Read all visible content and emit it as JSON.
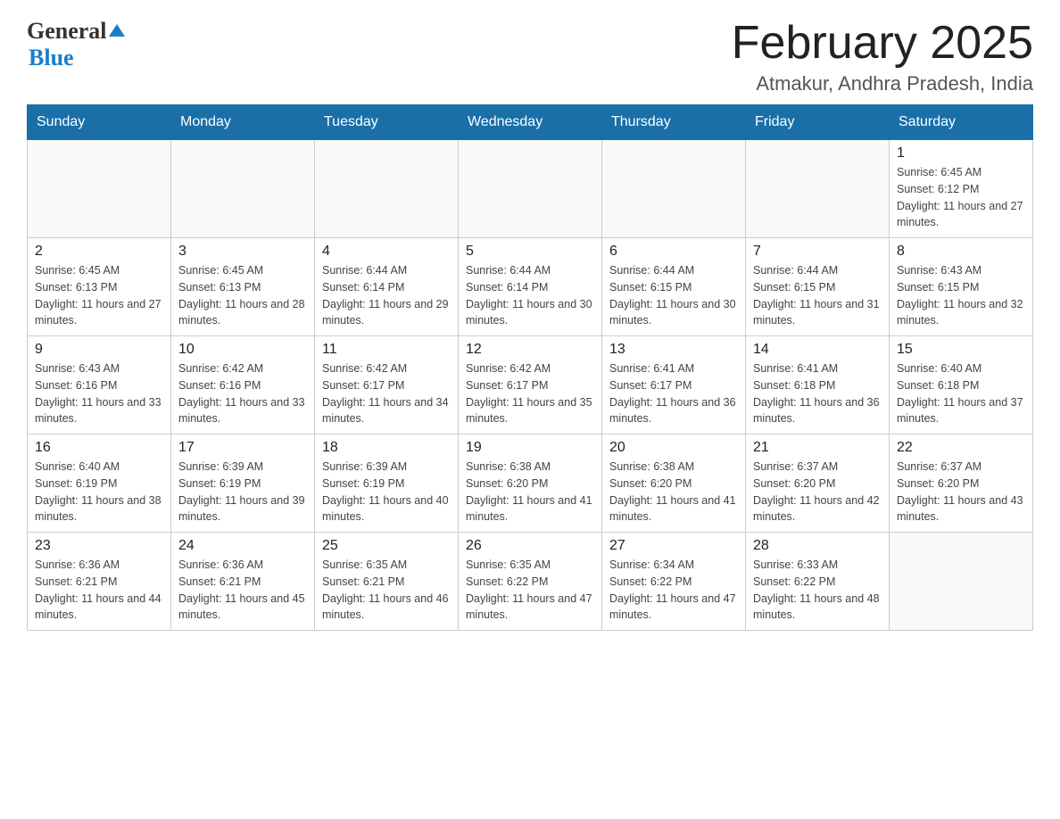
{
  "logo": {
    "general": "General",
    "blue": "Blue"
  },
  "header": {
    "title": "February 2025",
    "subtitle": "Atmakur, Andhra Pradesh, India"
  },
  "weekdays": [
    "Sunday",
    "Monday",
    "Tuesday",
    "Wednesday",
    "Thursday",
    "Friday",
    "Saturday"
  ],
  "weeks": [
    [
      {
        "day": "",
        "info": ""
      },
      {
        "day": "",
        "info": ""
      },
      {
        "day": "",
        "info": ""
      },
      {
        "day": "",
        "info": ""
      },
      {
        "day": "",
        "info": ""
      },
      {
        "day": "",
        "info": ""
      },
      {
        "day": "1",
        "info": "Sunrise: 6:45 AM\nSunset: 6:12 PM\nDaylight: 11 hours and 27 minutes."
      }
    ],
    [
      {
        "day": "2",
        "info": "Sunrise: 6:45 AM\nSunset: 6:13 PM\nDaylight: 11 hours and 27 minutes."
      },
      {
        "day": "3",
        "info": "Sunrise: 6:45 AM\nSunset: 6:13 PM\nDaylight: 11 hours and 28 minutes."
      },
      {
        "day": "4",
        "info": "Sunrise: 6:44 AM\nSunset: 6:14 PM\nDaylight: 11 hours and 29 minutes."
      },
      {
        "day": "5",
        "info": "Sunrise: 6:44 AM\nSunset: 6:14 PM\nDaylight: 11 hours and 30 minutes."
      },
      {
        "day": "6",
        "info": "Sunrise: 6:44 AM\nSunset: 6:15 PM\nDaylight: 11 hours and 30 minutes."
      },
      {
        "day": "7",
        "info": "Sunrise: 6:44 AM\nSunset: 6:15 PM\nDaylight: 11 hours and 31 minutes."
      },
      {
        "day": "8",
        "info": "Sunrise: 6:43 AM\nSunset: 6:15 PM\nDaylight: 11 hours and 32 minutes."
      }
    ],
    [
      {
        "day": "9",
        "info": "Sunrise: 6:43 AM\nSunset: 6:16 PM\nDaylight: 11 hours and 33 minutes."
      },
      {
        "day": "10",
        "info": "Sunrise: 6:42 AM\nSunset: 6:16 PM\nDaylight: 11 hours and 33 minutes."
      },
      {
        "day": "11",
        "info": "Sunrise: 6:42 AM\nSunset: 6:17 PM\nDaylight: 11 hours and 34 minutes."
      },
      {
        "day": "12",
        "info": "Sunrise: 6:42 AM\nSunset: 6:17 PM\nDaylight: 11 hours and 35 minutes."
      },
      {
        "day": "13",
        "info": "Sunrise: 6:41 AM\nSunset: 6:17 PM\nDaylight: 11 hours and 36 minutes."
      },
      {
        "day": "14",
        "info": "Sunrise: 6:41 AM\nSunset: 6:18 PM\nDaylight: 11 hours and 36 minutes."
      },
      {
        "day": "15",
        "info": "Sunrise: 6:40 AM\nSunset: 6:18 PM\nDaylight: 11 hours and 37 minutes."
      }
    ],
    [
      {
        "day": "16",
        "info": "Sunrise: 6:40 AM\nSunset: 6:19 PM\nDaylight: 11 hours and 38 minutes."
      },
      {
        "day": "17",
        "info": "Sunrise: 6:39 AM\nSunset: 6:19 PM\nDaylight: 11 hours and 39 minutes."
      },
      {
        "day": "18",
        "info": "Sunrise: 6:39 AM\nSunset: 6:19 PM\nDaylight: 11 hours and 40 minutes."
      },
      {
        "day": "19",
        "info": "Sunrise: 6:38 AM\nSunset: 6:20 PM\nDaylight: 11 hours and 41 minutes."
      },
      {
        "day": "20",
        "info": "Sunrise: 6:38 AM\nSunset: 6:20 PM\nDaylight: 11 hours and 41 minutes."
      },
      {
        "day": "21",
        "info": "Sunrise: 6:37 AM\nSunset: 6:20 PM\nDaylight: 11 hours and 42 minutes."
      },
      {
        "day": "22",
        "info": "Sunrise: 6:37 AM\nSunset: 6:20 PM\nDaylight: 11 hours and 43 minutes."
      }
    ],
    [
      {
        "day": "23",
        "info": "Sunrise: 6:36 AM\nSunset: 6:21 PM\nDaylight: 11 hours and 44 minutes."
      },
      {
        "day": "24",
        "info": "Sunrise: 6:36 AM\nSunset: 6:21 PM\nDaylight: 11 hours and 45 minutes."
      },
      {
        "day": "25",
        "info": "Sunrise: 6:35 AM\nSunset: 6:21 PM\nDaylight: 11 hours and 46 minutes."
      },
      {
        "day": "26",
        "info": "Sunrise: 6:35 AM\nSunset: 6:22 PM\nDaylight: 11 hours and 47 minutes."
      },
      {
        "day": "27",
        "info": "Sunrise: 6:34 AM\nSunset: 6:22 PM\nDaylight: 11 hours and 47 minutes."
      },
      {
        "day": "28",
        "info": "Sunrise: 6:33 AM\nSunset: 6:22 PM\nDaylight: 11 hours and 48 minutes."
      },
      {
        "day": "",
        "info": ""
      }
    ]
  ]
}
